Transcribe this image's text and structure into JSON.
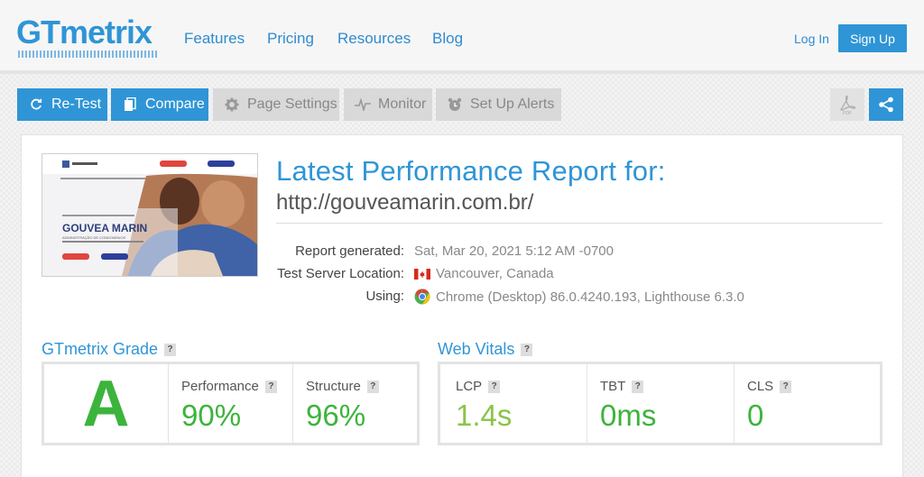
{
  "header": {
    "logo": "GTmetrix",
    "nav": [
      "Features",
      "Pricing",
      "Resources",
      "Blog"
    ],
    "login": "Log In",
    "signup": "Sign Up"
  },
  "toolbar": {
    "retest": "Re-Test",
    "compare": "Compare",
    "page_settings": "Page Settings",
    "monitor": "Monitor",
    "alerts": "Set Up Alerts"
  },
  "thumbnail": {
    "brand": "GOUVEA MARIN",
    "sub": "ADMINISTRAÇÃO DE CONDOMÍNIOS"
  },
  "report": {
    "title": "Latest Performance Report for:",
    "url": "http://gouveamarin.com.br/",
    "generated_label": "Report generated:",
    "generated_value": "Sat, Mar 20, 2021 5:12 AM -0700",
    "location_label": "Test Server Location:",
    "location_value": "Vancouver, Canada",
    "using_label": "Using:",
    "using_value": "Chrome (Desktop) 86.0.4240.193, Lighthouse 6.3.0"
  },
  "grade": {
    "title": "GTmetrix Grade",
    "letter": "A",
    "performance_label": "Performance",
    "performance_value": "90%",
    "structure_label": "Structure",
    "structure_value": "96%"
  },
  "vitals": {
    "title": "Web Vitals",
    "lcp_label": "LCP",
    "lcp_value": "1.4s",
    "tbt_label": "TBT",
    "tbt_value": "0ms",
    "cls_label": "CLS",
    "cls_value": "0"
  },
  "help_mark": "?",
  "colors": {
    "brand": "#2f95d6",
    "good_green": "#3cb43c",
    "lcp_green": "#8bc34a"
  }
}
